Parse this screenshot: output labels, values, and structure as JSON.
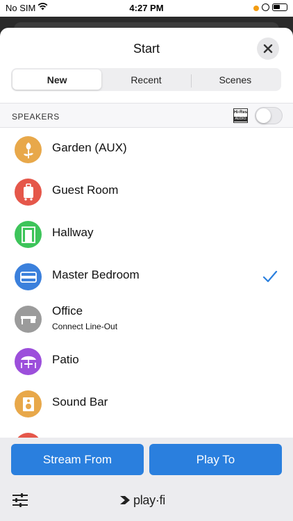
{
  "status_bar": {
    "carrier": "No SIM",
    "time": "4:27 PM"
  },
  "sheet": {
    "title": "Start"
  },
  "tabs": [
    {
      "label": "New",
      "active": true
    },
    {
      "label": "Recent",
      "active": false
    },
    {
      "label": "Scenes",
      "active": false
    }
  ],
  "speakers_section": {
    "label": "SPEAKERS",
    "hires_badge": {
      "top": "Hi-Res",
      "bottom": "AUDIO"
    },
    "hires_toggle_on": false
  },
  "speakers": [
    {
      "name": "Garden (AUX)",
      "color": "#E8A84A",
      "icon": "flower-icon",
      "selected": false,
      "subtitle": ""
    },
    {
      "name": "Guest Room",
      "color": "#E5574A",
      "icon": "suitcase-icon",
      "selected": false,
      "subtitle": ""
    },
    {
      "name": "Hallway",
      "color": "#3DC45A",
      "icon": "doorway-icon",
      "selected": false,
      "subtitle": ""
    },
    {
      "name": "Master Bedroom",
      "color": "#3B80DC",
      "icon": "bed-icon",
      "selected": true,
      "subtitle": ""
    },
    {
      "name": "Office",
      "color": "#9B9B9B",
      "icon": "desk-icon",
      "selected": false,
      "subtitle": "Connect Line-Out"
    },
    {
      "name": "Patio",
      "color": "#9C4FDB",
      "icon": "patio-table-icon",
      "selected": false,
      "subtitle": ""
    },
    {
      "name": "Sound Bar",
      "color": "#E8A84A",
      "icon": "speaker-icon",
      "selected": false,
      "subtitle": ""
    },
    {
      "name": "",
      "color": "#E5574A",
      "icon": "partial-icon",
      "selected": false,
      "subtitle": ""
    }
  ],
  "bottom_bar": {
    "stream_from_label": "Stream From",
    "play_to_label": "Play To",
    "logo_text": "play·fi"
  },
  "colors": {
    "accent": "#2A7FDE",
    "check": "#2A7FDE"
  }
}
